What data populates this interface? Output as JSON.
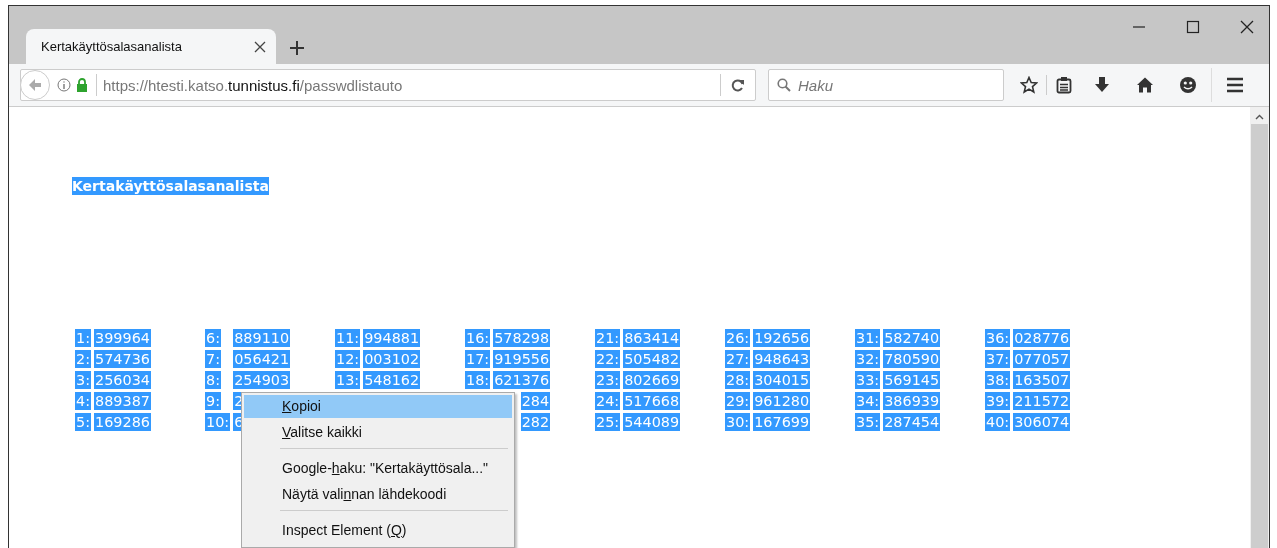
{
  "tab": {
    "title": "Kertakäyttösalasanalista",
    "selected": true
  },
  "address_bar": {
    "prefix": "https://htesti.katso.",
    "domain": "tunnistus.fi",
    "path": "/passwdlistauto"
  },
  "search": {
    "placeholder": "Haku"
  },
  "page": {
    "heading": "Kertakäyttösalasanalista",
    "columns": [
      {
        "items": [
          {
            "label": "1:",
            "value": "399964"
          },
          {
            "label": "2:",
            "value": "574736"
          },
          {
            "label": "3:",
            "value": "256034"
          },
          {
            "label": "4:",
            "value": "889387"
          },
          {
            "label": "5:",
            "value": "169286"
          }
        ]
      },
      {
        "items": [
          {
            "label": "6:",
            "value": "889110"
          },
          {
            "label": "7:",
            "value": "056421"
          },
          {
            "label": "8:",
            "value": "254903"
          },
          {
            "label": "9:",
            "value": "2"
          },
          {
            "label": "10:",
            "value": "6"
          }
        ]
      },
      {
        "items": [
          {
            "label": "11:",
            "value": "994881"
          },
          {
            "label": "12:",
            "value": "003102"
          },
          {
            "label": "13:",
            "value": "548162"
          }
        ]
      },
      {
        "items": [
          {
            "label": "16:",
            "value": "578298"
          },
          {
            "label": "17:",
            "value": "919556"
          },
          {
            "label": "18:",
            "value": "621376"
          },
          {
            "value": "284"
          },
          {
            "value": "282"
          }
        ]
      },
      {
        "items": [
          {
            "label": "21:",
            "value": "863414"
          },
          {
            "label": "22:",
            "value": "505482"
          },
          {
            "label": "23:",
            "value": "802669"
          },
          {
            "label": "24:",
            "value": "517668"
          },
          {
            "label": "25:",
            "value": "544089"
          }
        ]
      },
      {
        "items": [
          {
            "label": "26:",
            "value": "192656"
          },
          {
            "label": "27:",
            "value": "948643"
          },
          {
            "label": "28:",
            "value": "304015"
          },
          {
            "label": "29:",
            "value": "961280"
          },
          {
            "label": "30:",
            "value": "167699"
          }
        ]
      },
      {
        "items": [
          {
            "label": "31:",
            "value": "582740"
          },
          {
            "label": "32:",
            "value": "780590"
          },
          {
            "label": "33:",
            "value": "569145"
          },
          {
            "label": "34:",
            "value": "386939"
          },
          {
            "label": "35:",
            "value": "287454"
          }
        ]
      },
      {
        "items": [
          {
            "label": "36:",
            "value": "028776"
          },
          {
            "label": "37:",
            "value": "077057"
          },
          {
            "label": "38:",
            "value": "163507"
          },
          {
            "label": "39:",
            "value": "211572"
          },
          {
            "label": "40:",
            "value": "306074"
          }
        ]
      }
    ]
  },
  "context_menu": {
    "items": [
      {
        "kind": "item",
        "key": "K",
        "after": "opioi",
        "selected": true
      },
      {
        "kind": "item",
        "key": "V",
        "after": "alitse kaikki",
        "selected": false
      },
      {
        "kind": "separator"
      },
      {
        "kind": "item",
        "before": "Google-",
        "key": "h",
        "after": "aku: \"Kertakäyttösala...\"",
        "selected": false
      },
      {
        "kind": "item",
        "before": "Näytä vali",
        "key": "n",
        "after": "nan lähdekoodi",
        "selected": false
      },
      {
        "kind": "separator"
      },
      {
        "kind": "item",
        "before": "Inspect Element (",
        "key": "Q",
        "after": ")",
        "selected": false
      }
    ]
  }
}
